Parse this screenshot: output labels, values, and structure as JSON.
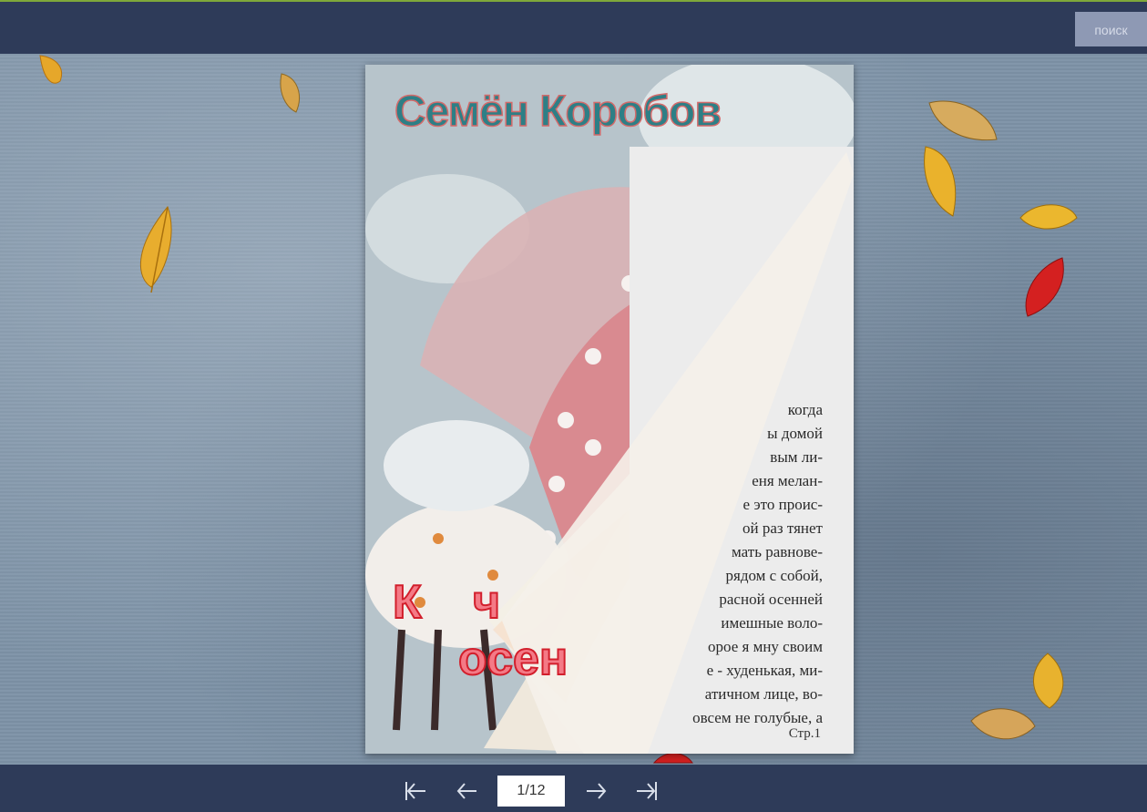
{
  "header": {
    "search_label": "поиск"
  },
  "book": {
    "author": "Семён Коробов",
    "title_fragment_1": "К",
    "title_fragment_2": "ч",
    "title_fragment_3": "осен",
    "page_lines": [
      "когда",
      "ы домой",
      "вым ли-",
      "еня мелан-",
      "е это проис-",
      "ой раз тянет",
      "мать равнове-",
      "рядом с собой,",
      "расной осенней",
      "имешные воло-",
      "орое я мну своим",
      "е - худенькая, ми-",
      "атичном лице, во-",
      "овсем не голубые, а"
    ],
    "page_number": "Стр.1"
  },
  "navigation": {
    "first_icon": "first-page-icon",
    "prev_icon": "prev-page-icon",
    "next_icon": "next-page-icon",
    "last_icon": "last-page-icon",
    "page_indicator": "1/12"
  },
  "colors": {
    "bar": "#2e3b59",
    "accent_line": "#7fa83a",
    "author": "#2d7f86",
    "title": "#d21f2c"
  }
}
